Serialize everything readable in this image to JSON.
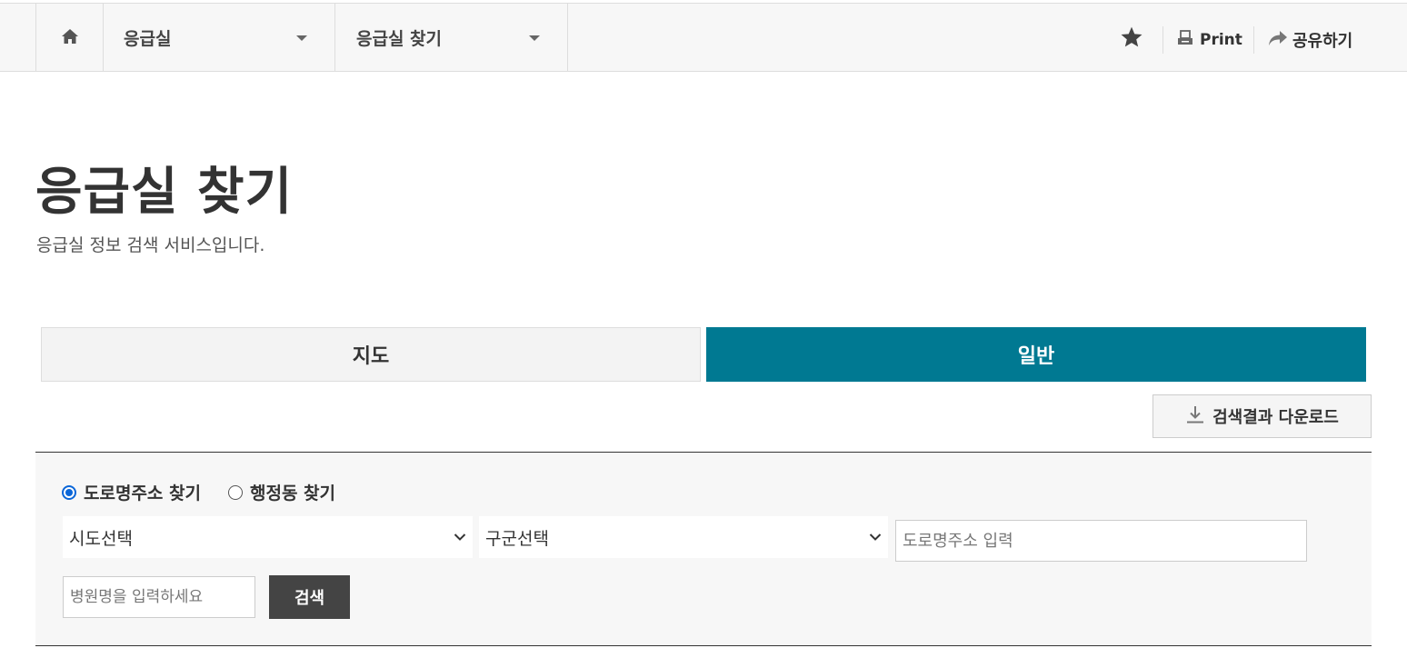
{
  "breadcrumb": {
    "home_icon": "home-icon",
    "level1": "응급실",
    "level2": "응급실 찾기"
  },
  "tools": {
    "star_icon": "star-icon",
    "print_label": "Print",
    "share_label": "공유하기"
  },
  "page": {
    "title": "응급실 찾기",
    "description": "응급실 정보 검색 서비스입니다."
  },
  "tabs": [
    {
      "label": "지도",
      "active": false
    },
    {
      "label": "일반",
      "active": true
    }
  ],
  "download": {
    "label": "검색결과 다운로드",
    "icon": "download-icon"
  },
  "search": {
    "radio_road": "도로명주소 찾기",
    "radio_admin": "행정동 찾기",
    "selected_radio": "도로명주소 찾기",
    "sido_value": "시도선택",
    "gugun_value": "구군선택",
    "road_placeholder": "도로명주소 입력",
    "hospital_placeholder": "병원명을 입력하세요",
    "button_label": "검색"
  },
  "colors": {
    "accent_tab": "#007992",
    "radio_checked": "#0a66d8",
    "search_button": "#444444"
  }
}
